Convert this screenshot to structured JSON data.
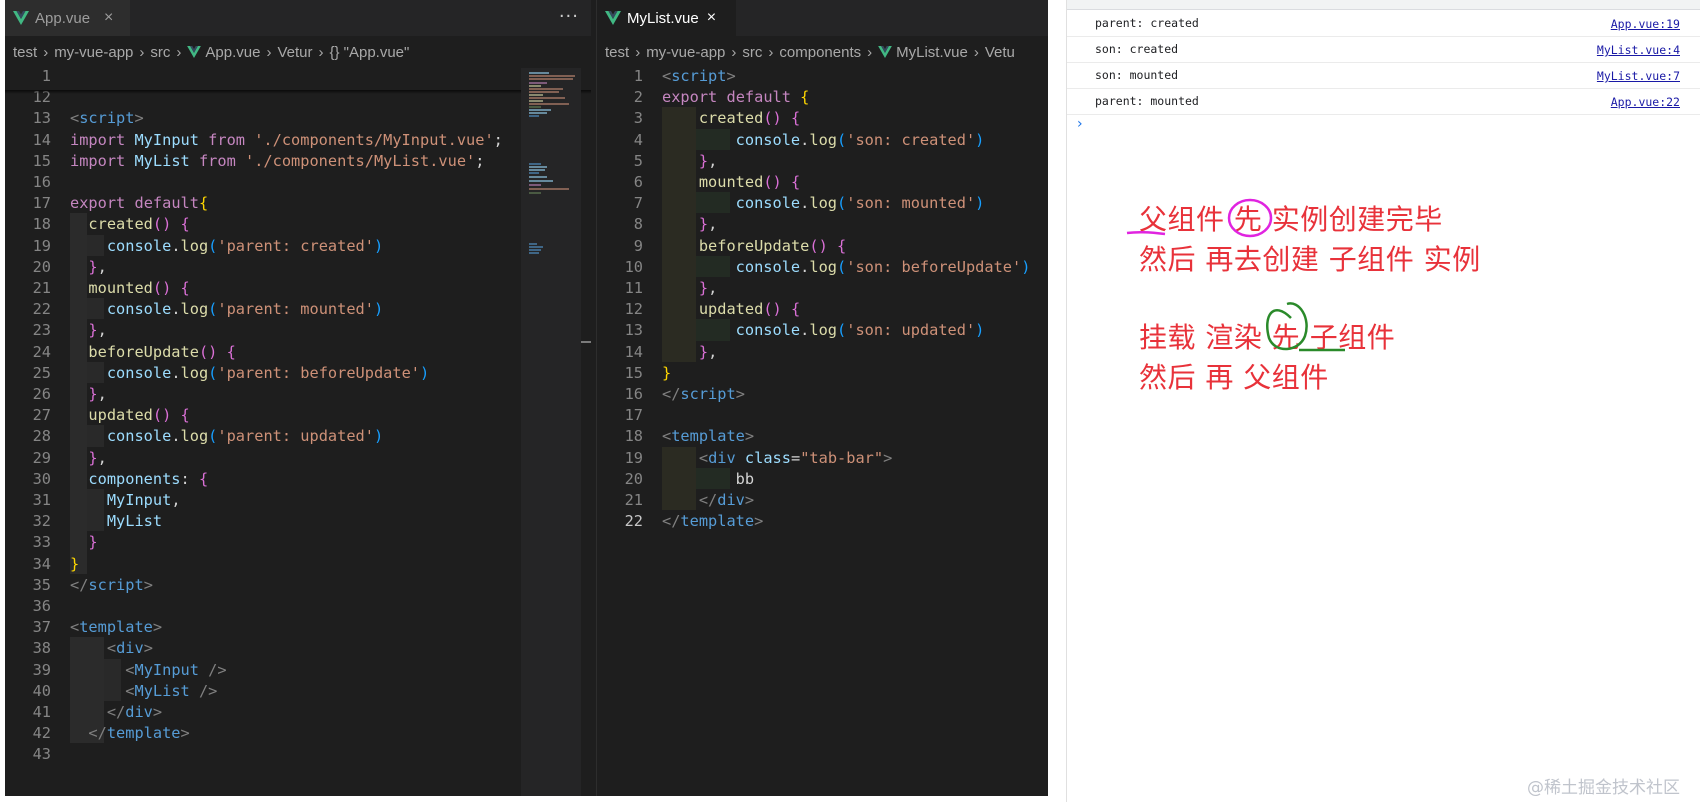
{
  "left_editor": {
    "tab_label": "App.vue",
    "more_actions": "···",
    "close_glyph": "×",
    "breadcrumb": [
      "test",
      "my-vue-app",
      "src",
      "App.vue",
      "Vetur",
      "{} \"App.vue\""
    ]
  },
  "right_editor": {
    "tab_label": "MyList.vue",
    "close_glyph": "×",
    "breadcrumb": [
      "test",
      "my-vue-app",
      "src",
      "components",
      "MyList.vue",
      "Vetu"
    ]
  },
  "left_code": [
    {
      "ln": "1",
      "tokens": []
    },
    {
      "ln": "12",
      "tokens": []
    },
    {
      "ln": "13",
      "tokens": [
        {
          "t": "<",
          "c": "ang"
        },
        {
          "t": "script",
          "c": "tg"
        },
        {
          "t": ">",
          "c": "ang"
        }
      ]
    },
    {
      "ln": "14",
      "tokens": [
        {
          "t": "import",
          "c": "kw"
        },
        {
          "t": " MyInput ",
          "c": "var"
        },
        {
          "t": "from",
          "c": "kw"
        },
        {
          "t": " './components/MyInput.vue'",
          "c": "str"
        },
        {
          "t": ";",
          "c": "pl"
        }
      ]
    },
    {
      "ln": "15",
      "tokens": [
        {
          "t": "import",
          "c": "kw"
        },
        {
          "t": " MyList ",
          "c": "var"
        },
        {
          "t": "from",
          "c": "kw"
        },
        {
          "t": " './components/MyList.vue'",
          "c": "str"
        },
        {
          "t": ";",
          "c": "pl"
        }
      ]
    },
    {
      "ln": "16",
      "tokens": []
    },
    {
      "ln": "17",
      "tokens": [
        {
          "t": "export",
          "c": "kw"
        },
        {
          "t": " ",
          "c": "pl"
        },
        {
          "t": "default",
          "c": "kw"
        },
        {
          "t": "{",
          "c": "br1"
        }
      ]
    },
    {
      "ln": "18",
      "tokens": [
        {
          "t": "  ",
          "c": "pl"
        },
        {
          "t": "created",
          "c": "fn"
        },
        {
          "t": "()",
          "c": "br2"
        },
        {
          "t": " ",
          "c": "pl"
        },
        {
          "t": "{",
          "c": "br2"
        }
      ]
    },
    {
      "ln": "19",
      "tokens": [
        {
          "t": "    console",
          "c": "var"
        },
        {
          "t": ".",
          "c": "pl"
        },
        {
          "t": "log",
          "c": "fn"
        },
        {
          "t": "(",
          "c": "br3"
        },
        {
          "t": "'parent: created'",
          "c": "str"
        },
        {
          "t": ")",
          "c": "br3"
        }
      ]
    },
    {
      "ln": "20",
      "tokens": [
        {
          "t": "  ",
          "c": "pl"
        },
        {
          "t": "}",
          "c": "br2"
        },
        {
          "t": ",",
          "c": "pl"
        }
      ]
    },
    {
      "ln": "21",
      "tokens": [
        {
          "t": "  ",
          "c": "pl"
        },
        {
          "t": "mounted",
          "c": "fn"
        },
        {
          "t": "()",
          "c": "br2"
        },
        {
          "t": " ",
          "c": "pl"
        },
        {
          "t": "{",
          "c": "br2"
        }
      ]
    },
    {
      "ln": "22",
      "tokens": [
        {
          "t": "    console",
          "c": "var"
        },
        {
          "t": ".",
          "c": "pl"
        },
        {
          "t": "log",
          "c": "fn"
        },
        {
          "t": "(",
          "c": "br3"
        },
        {
          "t": "'parent: mounted'",
          "c": "str"
        },
        {
          "t": ")",
          "c": "br3"
        }
      ]
    },
    {
      "ln": "23",
      "tokens": [
        {
          "t": "  ",
          "c": "pl"
        },
        {
          "t": "}",
          "c": "br2"
        },
        {
          "t": ",",
          "c": "pl"
        }
      ]
    },
    {
      "ln": "24",
      "tokens": [
        {
          "t": "  ",
          "c": "pl"
        },
        {
          "t": "beforeUpdate",
          "c": "fn"
        },
        {
          "t": "()",
          "c": "br2"
        },
        {
          "t": " ",
          "c": "pl"
        },
        {
          "t": "{",
          "c": "br2"
        }
      ]
    },
    {
      "ln": "25",
      "tokens": [
        {
          "t": "    console",
          "c": "var"
        },
        {
          "t": ".",
          "c": "pl"
        },
        {
          "t": "log",
          "c": "fn"
        },
        {
          "t": "(",
          "c": "br3"
        },
        {
          "t": "'parent: beforeUpdate'",
          "c": "str"
        },
        {
          "t": ")",
          "c": "br3"
        }
      ]
    },
    {
      "ln": "26",
      "tokens": [
        {
          "t": "  ",
          "c": "pl"
        },
        {
          "t": "}",
          "c": "br2"
        },
        {
          "t": ",",
          "c": "pl"
        }
      ]
    },
    {
      "ln": "27",
      "tokens": [
        {
          "t": "  ",
          "c": "pl"
        },
        {
          "t": "updated",
          "c": "fn"
        },
        {
          "t": "()",
          "c": "br2"
        },
        {
          "t": " ",
          "c": "pl"
        },
        {
          "t": "{",
          "c": "br2"
        }
      ]
    },
    {
      "ln": "28",
      "tokens": [
        {
          "t": "    console",
          "c": "var"
        },
        {
          "t": ".",
          "c": "pl"
        },
        {
          "t": "log",
          "c": "fn"
        },
        {
          "t": "(",
          "c": "br3"
        },
        {
          "t": "'parent: updated'",
          "c": "str"
        },
        {
          "t": ")",
          "c": "br3"
        }
      ]
    },
    {
      "ln": "29",
      "tokens": [
        {
          "t": "  ",
          "c": "pl"
        },
        {
          "t": "}",
          "c": "br2"
        },
        {
          "t": ",",
          "c": "pl"
        }
      ]
    },
    {
      "ln": "30",
      "tokens": [
        {
          "t": "  components",
          "c": "var"
        },
        {
          "t": ": ",
          "c": "pl"
        },
        {
          "t": "{",
          "c": "br2"
        }
      ]
    },
    {
      "ln": "31",
      "tokens": [
        {
          "t": "    MyInput",
          "c": "var"
        },
        {
          "t": ",",
          "c": "pl"
        }
      ]
    },
    {
      "ln": "32",
      "tokens": [
        {
          "t": "    MyList",
          "c": "var"
        }
      ]
    },
    {
      "ln": "33",
      "tokens": [
        {
          "t": "  ",
          "c": "pl"
        },
        {
          "t": "}",
          "c": "br2"
        }
      ]
    },
    {
      "ln": "34",
      "tokens": [
        {
          "t": "}",
          "c": "br1"
        }
      ]
    },
    {
      "ln": "35",
      "tokens": [
        {
          "t": "</",
          "c": "ang"
        },
        {
          "t": "script",
          "c": "tg"
        },
        {
          "t": ">",
          "c": "ang"
        }
      ]
    },
    {
      "ln": "36",
      "tokens": []
    },
    {
      "ln": "37",
      "tokens": [
        {
          "t": "<",
          "c": "ang"
        },
        {
          "t": "template",
          "c": "tg"
        },
        {
          "t": ">",
          "c": "ang"
        }
      ]
    },
    {
      "ln": "38",
      "tokens": [
        {
          "t": "    ",
          "c": "pl"
        },
        {
          "t": "<",
          "c": "ang"
        },
        {
          "t": "div",
          "c": "tg"
        },
        {
          "t": ">",
          "c": "ang"
        }
      ]
    },
    {
      "ln": "39",
      "tokens": [
        {
          "t": "      ",
          "c": "pl"
        },
        {
          "t": "<",
          "c": "ang"
        },
        {
          "t": "MyInput",
          "c": "tg"
        },
        {
          "t": " />",
          "c": "ang"
        }
      ]
    },
    {
      "ln": "40",
      "tokens": [
        {
          "t": "      ",
          "c": "pl"
        },
        {
          "t": "<",
          "c": "ang"
        },
        {
          "t": "MyList",
          "c": "tg"
        },
        {
          "t": " />",
          "c": "ang"
        }
      ]
    },
    {
      "ln": "41",
      "tokens": [
        {
          "t": "    ",
          "c": "pl"
        },
        {
          "t": "</",
          "c": "ang"
        },
        {
          "t": "div",
          "c": "tg"
        },
        {
          "t": ">",
          "c": "ang"
        }
      ]
    },
    {
      "ln": "42",
      "tokens": [
        {
          "t": "  ",
          "c": "pl"
        },
        {
          "t": "</",
          "c": "ang"
        },
        {
          "t": "template",
          "c": "tg"
        },
        {
          "t": ">",
          "c": "ang"
        }
      ]
    },
    {
      "ln": "43",
      "tokens": []
    }
  ],
  "right_code": [
    {
      "ln": "1",
      "tokens": [
        {
          "t": "<",
          "c": "ang"
        },
        {
          "t": "script",
          "c": "tg"
        },
        {
          "t": ">",
          "c": "ang"
        }
      ]
    },
    {
      "ln": "2",
      "tokens": [
        {
          "t": "export",
          "c": "kw"
        },
        {
          "t": " ",
          "c": "pl"
        },
        {
          "t": "default",
          "c": "kw"
        },
        {
          "t": " ",
          "c": "pl"
        },
        {
          "t": "{",
          "c": "br1"
        }
      ]
    },
    {
      "ln": "3",
      "tokens": [
        {
          "t": "    ",
          "c": "pl"
        },
        {
          "t": "created",
          "c": "fn"
        },
        {
          "t": "()",
          "c": "br2"
        },
        {
          "t": " ",
          "c": "pl"
        },
        {
          "t": "{",
          "c": "br2"
        }
      ]
    },
    {
      "ln": "4",
      "tokens": [
        {
          "t": "        console",
          "c": "var"
        },
        {
          "t": ".",
          "c": "pl"
        },
        {
          "t": "log",
          "c": "fn"
        },
        {
          "t": "(",
          "c": "br3"
        },
        {
          "t": "'son: created'",
          "c": "str"
        },
        {
          "t": ")",
          "c": "br3"
        }
      ]
    },
    {
      "ln": "5",
      "tokens": [
        {
          "t": "    ",
          "c": "pl"
        },
        {
          "t": "}",
          "c": "br2"
        },
        {
          "t": ",",
          "c": "pl"
        }
      ]
    },
    {
      "ln": "6",
      "tokens": [
        {
          "t": "    ",
          "c": "pl"
        },
        {
          "t": "mounted",
          "c": "fn"
        },
        {
          "t": "()",
          "c": "br2"
        },
        {
          "t": " ",
          "c": "pl"
        },
        {
          "t": "{",
          "c": "br2"
        }
      ]
    },
    {
      "ln": "7",
      "tokens": [
        {
          "t": "        console",
          "c": "var"
        },
        {
          "t": ".",
          "c": "pl"
        },
        {
          "t": "log",
          "c": "fn"
        },
        {
          "t": "(",
          "c": "br3"
        },
        {
          "t": "'son: mounted'",
          "c": "str"
        },
        {
          "t": ")",
          "c": "br3"
        }
      ]
    },
    {
      "ln": "8",
      "tokens": [
        {
          "t": "    ",
          "c": "pl"
        },
        {
          "t": "}",
          "c": "br2"
        },
        {
          "t": ",",
          "c": "pl"
        }
      ]
    },
    {
      "ln": "9",
      "tokens": [
        {
          "t": "    ",
          "c": "pl"
        },
        {
          "t": "beforeUpdate",
          "c": "fn"
        },
        {
          "t": "()",
          "c": "br2"
        },
        {
          "t": " ",
          "c": "pl"
        },
        {
          "t": "{",
          "c": "br2"
        }
      ]
    },
    {
      "ln": "10",
      "tokens": [
        {
          "t": "        console",
          "c": "var"
        },
        {
          "t": ".",
          "c": "pl"
        },
        {
          "t": "log",
          "c": "fn"
        },
        {
          "t": "(",
          "c": "br3"
        },
        {
          "t": "'son: beforeUpdate'",
          "c": "str"
        },
        {
          "t": ")",
          "c": "br3"
        }
      ]
    },
    {
      "ln": "11",
      "tokens": [
        {
          "t": "    ",
          "c": "pl"
        },
        {
          "t": "}",
          "c": "br2"
        },
        {
          "t": ",",
          "c": "pl"
        }
      ]
    },
    {
      "ln": "12",
      "tokens": [
        {
          "t": "    ",
          "c": "pl"
        },
        {
          "t": "updated",
          "c": "fn"
        },
        {
          "t": "()",
          "c": "br2"
        },
        {
          "t": " ",
          "c": "pl"
        },
        {
          "t": "{",
          "c": "br2"
        }
      ]
    },
    {
      "ln": "13",
      "tokens": [
        {
          "t": "        console",
          "c": "var"
        },
        {
          "t": ".",
          "c": "pl"
        },
        {
          "t": "log",
          "c": "fn"
        },
        {
          "t": "(",
          "c": "br3"
        },
        {
          "t": "'son: updated'",
          "c": "str"
        },
        {
          "t": ")",
          "c": "br3"
        }
      ]
    },
    {
      "ln": "14",
      "tokens": [
        {
          "t": "    ",
          "c": "pl"
        },
        {
          "t": "}",
          "c": "br2"
        },
        {
          "t": ",",
          "c": "pl"
        }
      ]
    },
    {
      "ln": "15",
      "tokens": [
        {
          "t": "}",
          "c": "br1"
        }
      ]
    },
    {
      "ln": "16",
      "tokens": [
        {
          "t": "</",
          "c": "ang"
        },
        {
          "t": "script",
          "c": "tg"
        },
        {
          "t": ">",
          "c": "ang"
        }
      ]
    },
    {
      "ln": "17",
      "tokens": []
    },
    {
      "ln": "18",
      "tokens": [
        {
          "t": "<",
          "c": "ang"
        },
        {
          "t": "template",
          "c": "tg"
        },
        {
          "t": ">",
          "c": "ang"
        }
      ]
    },
    {
      "ln": "19",
      "tokens": [
        {
          "t": "    ",
          "c": "pl"
        },
        {
          "t": "<",
          "c": "ang"
        },
        {
          "t": "div",
          "c": "tg"
        },
        {
          "t": " class",
          "c": "var"
        },
        {
          "t": "=",
          "c": "pl"
        },
        {
          "t": "\"tab-bar\"",
          "c": "str"
        },
        {
          "t": ">",
          "c": "ang"
        }
      ]
    },
    {
      "ln": "20",
      "tokens": [
        {
          "t": "        bb",
          "c": "pl"
        }
      ]
    },
    {
      "ln": "21",
      "tokens": [
        {
          "t": "    ",
          "c": "pl"
        },
        {
          "t": "</",
          "c": "ang"
        },
        {
          "t": "div",
          "c": "tg"
        },
        {
          "t": ">",
          "c": "ang"
        }
      ]
    },
    {
      "ln": "22",
      "tokens": [
        {
          "t": "</",
          "c": "ang"
        },
        {
          "t": "template",
          "c": "tg"
        },
        {
          "t": ">",
          "c": "ang"
        }
      ],
      "current": true
    }
  ],
  "console": {
    "logs": [
      {
        "message": "parent: created",
        "source": "App.vue:19"
      },
      {
        "message": "son: created",
        "source": "MyList.vue:4"
      },
      {
        "message": "son: mounted",
        "source": "MyList.vue:7"
      },
      {
        "message": "parent: mounted",
        "source": "App.vue:22"
      }
    ],
    "prompt_glyph": "›"
  },
  "annotations": {
    "line1": "父组件 先 实例创建完毕",
    "line2": "然后 再去创建 子组件 实例",
    "line3": "挂载 渲染 先 子组件",
    "line4": "然后 再 父组件"
  },
  "watermark": "@稀土掘金技术社区",
  "colors": {
    "editor_bg": "#1e1e1e",
    "annotation_red": "#e8323a",
    "circle_magenta": "#e024e0",
    "circle_green": "#2a8a2a",
    "link_blue": "#1a1aa6",
    "vue_green": "#41b883"
  }
}
